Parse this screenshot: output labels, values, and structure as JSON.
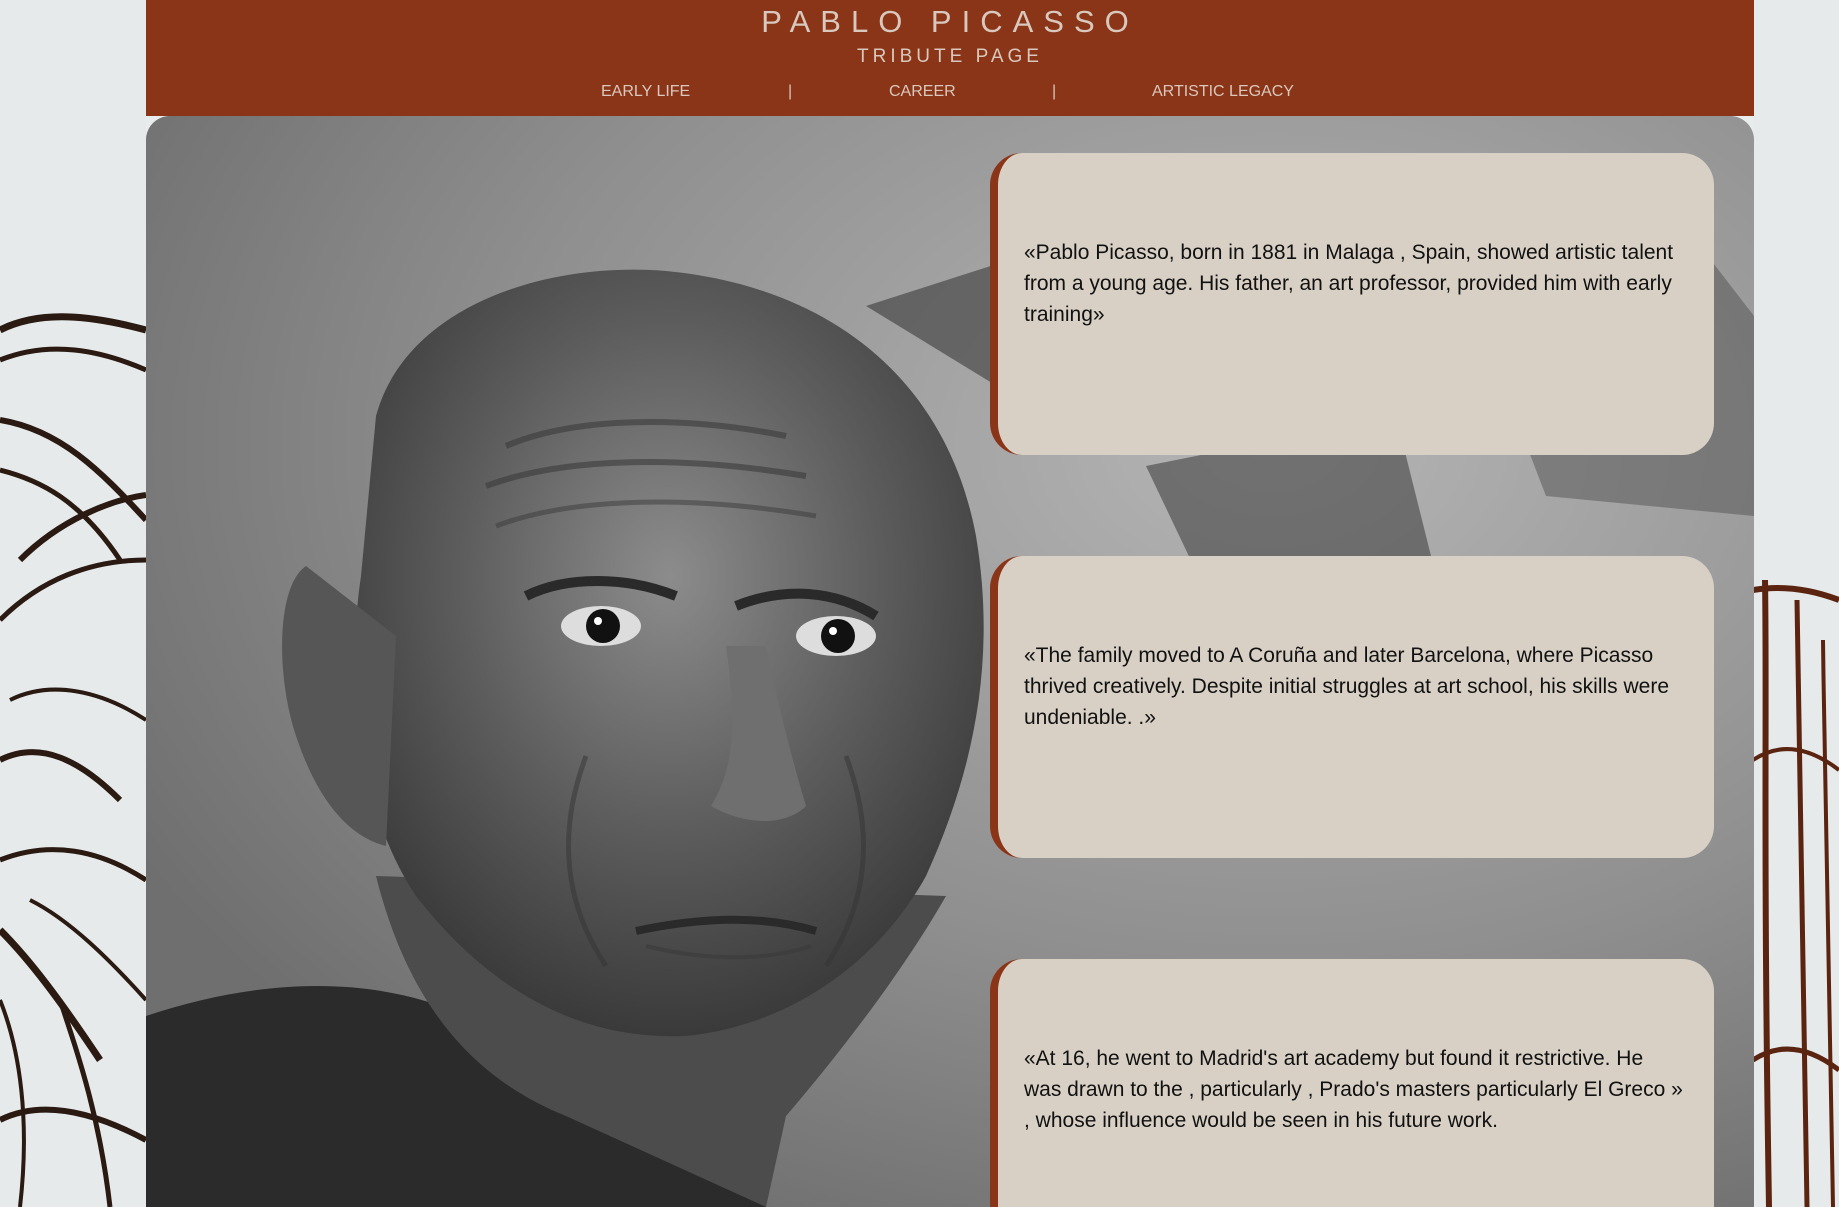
{
  "header": {
    "title": "PABLO PICASSO",
    "subtitle": "TRIBUTE PAGE"
  },
  "nav": {
    "items": [
      "EARLY LIFE",
      "CAREER",
      "ARTISTIC LEGACY"
    ],
    "separator": "|"
  },
  "cards": [
    {
      "text": "«Pablo Picasso, born in 1881 in Malaga , Spain, showed artistic talent from a young age. His father, an art professor, provided him with early training»"
    },
    {
      "text": "«The family moved to A Coruña and later Barcelona, where Picasso thrived creatively. Despite initial struggles at art school, his skills were undeniable. .»"
    },
    {
      "text": "«At 16, he went to Madrid's art academy but found it restrictive. He was drawn to the , particularly , Prado's masters particularly El Greco » , whose influence would be seen in his future work."
    }
  ],
  "colors": {
    "header_bg": "#8b3518",
    "header_text": "#d9c8bd",
    "card_bg": "#d8d0c5",
    "card_accent": "#8b3518"
  },
  "images": {
    "portrait": "black-and-white portrait photo",
    "side_background": "abstract painted strokes"
  }
}
